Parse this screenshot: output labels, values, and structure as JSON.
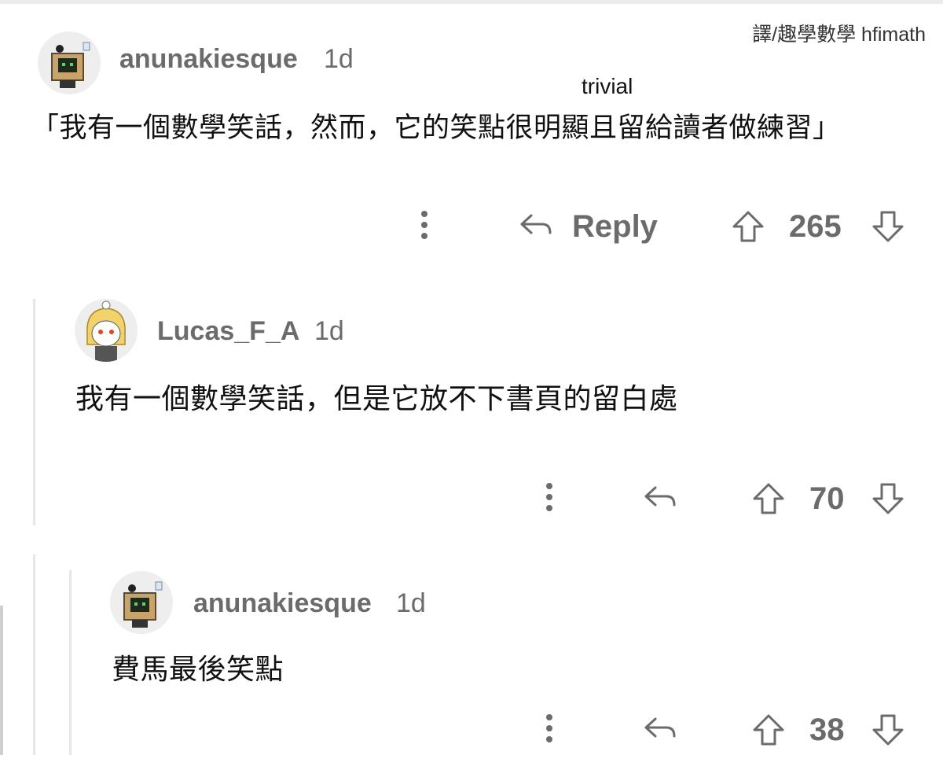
{
  "credit": "譯/趣學數學 hfimath",
  "comments": [
    {
      "username": "anunakiesque",
      "time": "1d",
      "text": "「我有一個數學笑話，然而，它的笑點很明顯且留給讀者做練習」",
      "annotation": "trivial",
      "reply_label": "Reply",
      "score": "265",
      "avatar_icon": "robot-box-avatar-icon"
    },
    {
      "username": "Lucas_F_A",
      "time": "1d",
      "text": "我有一個數學笑話，但是它放不下書頁的留白處",
      "score": "70",
      "avatar_icon": "blonde-character-avatar-icon"
    },
    {
      "username": "anunakiesque",
      "time": "1d",
      "text": "費馬最後笑點",
      "score": "38",
      "avatar_icon": "robot-box-avatar-icon"
    }
  ],
  "colors": {
    "meta": "#6b6b6b",
    "thread_line": "#e6e6e6",
    "text": "#111111"
  }
}
